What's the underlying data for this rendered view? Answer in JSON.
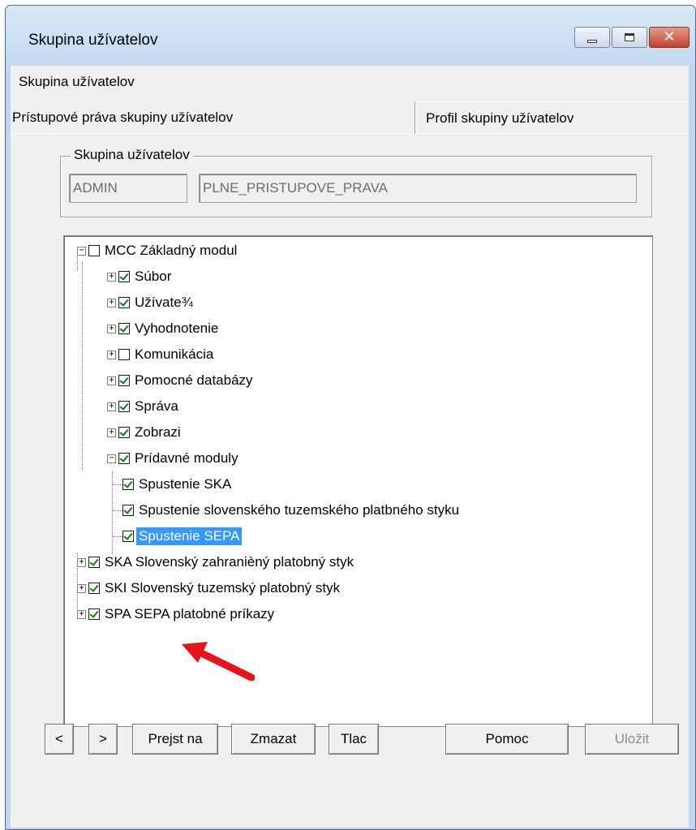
{
  "window": {
    "title": "Skupina užívatelov",
    "controls": {
      "minimize": "minimize-icon",
      "maximize": "maximize-icon",
      "close": "close-icon"
    }
  },
  "tabs": {
    "top": "Skupina užívatelov",
    "active": "Prístupové práva skupiny užívatelov",
    "inactive": "Profil skupiny užívatelov"
  },
  "group": {
    "legend": "Skupina užívatelov",
    "code": "ADMIN",
    "name": "PLNE_PRISTUPOVE_PRAVA"
  },
  "tree": {
    "root": {
      "label": "MCC Základný modul",
      "checked": false,
      "expanded": true
    },
    "children": [
      {
        "label": "Súbor",
        "checked": true
      },
      {
        "label": "Užívate¾",
        "checked": true
      },
      {
        "label": "Vyhodnotenie",
        "checked": true
      },
      {
        "label": "Komunikácia",
        "checked": false
      },
      {
        "label": "Pomocné databázy",
        "checked": true
      },
      {
        "label": "Správa",
        "checked": true
      },
      {
        "label": "Zobrazi",
        "checked": true
      },
      {
        "label": "Prídavné moduly",
        "checked": true,
        "expanded": true
      }
    ],
    "addons": [
      {
        "label": "Spustenie SKA",
        "checked": true
      },
      {
        "label": "Spustenie slovenského tuzemského platbného styku",
        "checked": true
      },
      {
        "label": "Spustenie SEPA",
        "checked": true,
        "selected": true
      }
    ],
    "roots": [
      {
        "label": "SKA Slovenský zahranièný platobný styk",
        "checked": true
      },
      {
        "label": "SKI Slovenský tuzemský platobný styk",
        "checked": true
      },
      {
        "label": "SPA SEPA platobné príkazy",
        "checked": true
      }
    ]
  },
  "buttons": {
    "prev": "<",
    "next": ">",
    "goto": "Prejst na",
    "delete": "Zmazat",
    "print": "Tlac",
    "help": "Pomoc",
    "save": "Uložit"
  },
  "colors": {
    "selection": "#3399ff",
    "annotation_arrow": "#e8141c",
    "check": "#117d11"
  }
}
